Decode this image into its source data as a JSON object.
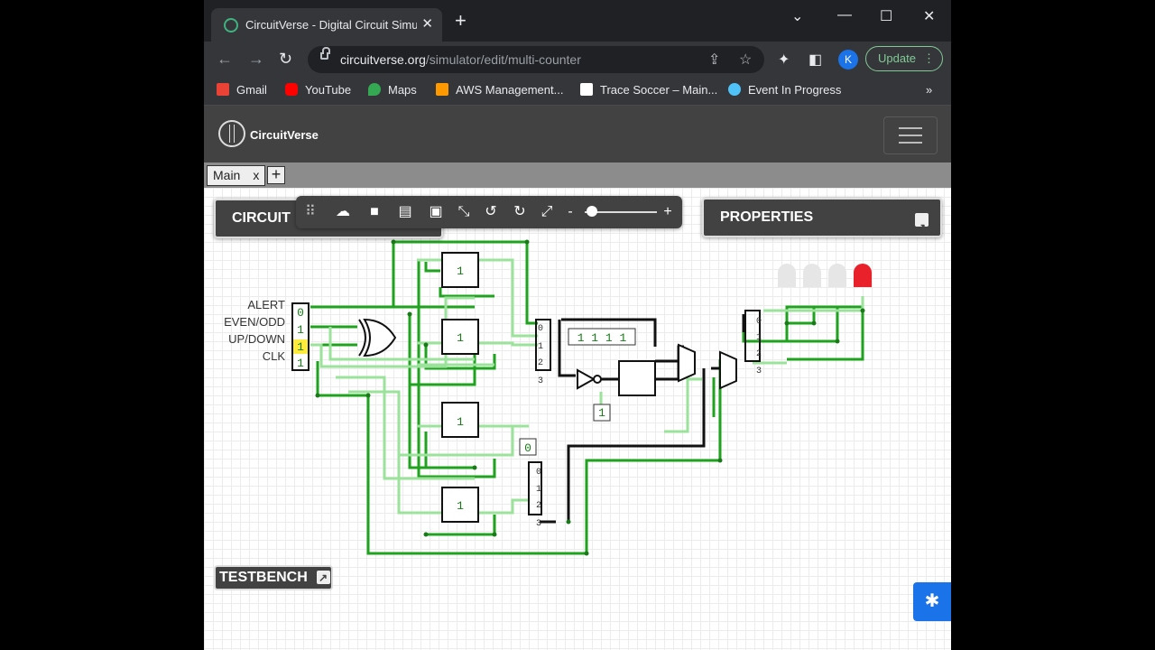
{
  "browser": {
    "tab_title": "CircuitVerse - Digital Circuit Simu",
    "tab_close": "✕",
    "new_tab": "+",
    "url_host": "circuitverse.org",
    "url_path": "/simulator/edit/multi-counter",
    "avatar_letter": "K",
    "update_label": "Update",
    "bookmarks": [
      {
        "label": "Gmail",
        "color": "#ea4335"
      },
      {
        "label": "YouTube",
        "color": "#ff0000"
      },
      {
        "label": "Maps",
        "color": "#34a853"
      },
      {
        "label": "AWS Management...",
        "color": "#ff9900"
      },
      {
        "label": "Trace Soccer – Main...",
        "color": "#ffffff"
      },
      {
        "label": "Event In Progress",
        "color": "#4fc3f7"
      }
    ],
    "more_bookmarks": "»"
  },
  "app": {
    "brand": "CircuitVerse",
    "circuit_tab": "Main",
    "circuit_tab_close": "x",
    "add_tab": "+",
    "circuit_panel": "CIRCUIT",
    "properties_panel": "PROPERTIES",
    "testbench": "TESTBENCH",
    "zoom_minus": "-",
    "zoom_plus": "+",
    "zoom_level": 0.1
  },
  "circuit": {
    "inputs": [
      {
        "label": "ALERT",
        "value": "0"
      },
      {
        "label": "EVEN/ODD",
        "value": "1"
      },
      {
        "label": "UP/DOWN",
        "value": "1"
      },
      {
        "label": "CLK",
        "value": "1"
      }
    ],
    "flipflop_values": [
      "1",
      "1",
      "1",
      "1"
    ],
    "display_value": "1 1 1 1",
    "const_one": "1",
    "const_zero": "0",
    "splitter_ports": [
      "0",
      "1",
      "2",
      "3"
    ],
    "mux_ports": [
      "0",
      "1"
    ],
    "leds": [
      "off",
      "off",
      "off",
      "on"
    ],
    "led_on_color": "#e8212b",
    "wire_active_color": "#1fa31f",
    "wire_inactive_color": "#9be29b"
  }
}
